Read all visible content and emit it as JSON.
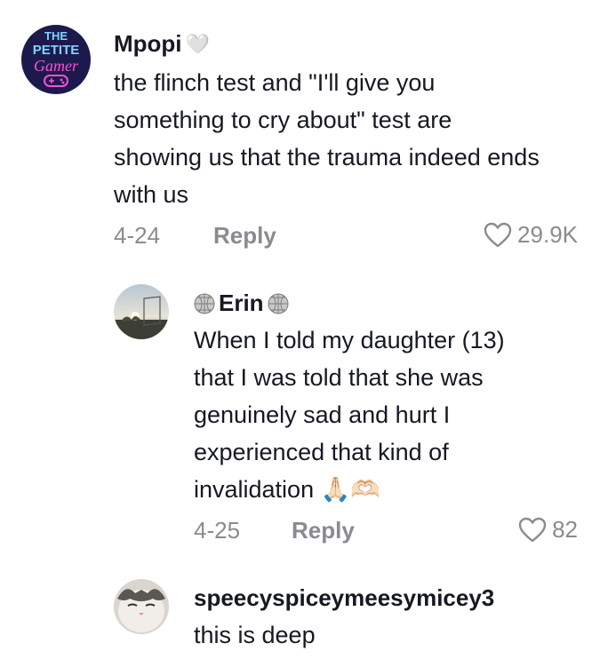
{
  "comments": [
    {
      "avatar_text": [
        "THE",
        "PETITE",
        "Gamer"
      ],
      "username": "Mpopi",
      "username_emoji": "🤍",
      "text_lines": [
        "the flinch test and \"I'll give you",
        "something to cry about\" test are",
        "showing us that the trauma indeed ends",
        "with us"
      ],
      "date": "4-24",
      "reply_label": "Reply",
      "likes": "29.9K"
    },
    {
      "username": "Erin",
      "text_lines": [
        "When I told my daughter (13)",
        "that I was told that she was",
        "genuinely sad and hurt I",
        "experienced that kind of",
        "invalidation 🙏🏻🫶🏻"
      ],
      "date": "4-25",
      "reply_label": "Reply",
      "likes": "82"
    },
    {
      "username": "speecyspiceymeesymicey3",
      "text_lines": [
        "this is deep"
      ]
    }
  ],
  "colors": {
    "text": "#161823",
    "muted": "#8a8b91",
    "avatar1_bg": "#1b1a4a",
    "avatar1_neon": "#ff4fd8"
  }
}
